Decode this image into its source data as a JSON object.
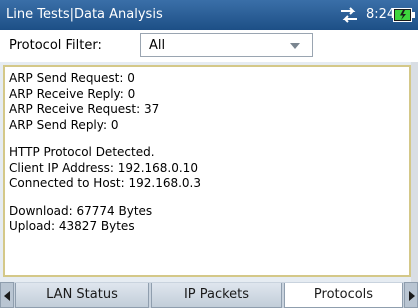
{
  "window": {
    "title": "Line Tests|Data Analysis",
    "time": "8:24",
    "network_icon": "network-activity-icon",
    "battery_icon": "battery-charging-icon"
  },
  "filter": {
    "label": "Protocol Filter:",
    "selected": "All"
  },
  "content": {
    "lines": [
      "ARP Send Request: 0",
      "ARP Receive Reply: 0",
      "ARP Receive Request: 37",
      "ARP Send Reply: 0",
      "",
      "HTTP Protocol Detected.",
      "Client IP Address: 192.168.0.10",
      "Connected to Host: 192.168.0.3",
      "",
      "Download: 67774 Bytes",
      "Upload: 43827 Bytes"
    ]
  },
  "tabs": [
    {
      "label": "LAN Status",
      "active": false
    },
    {
      "label": "IP Packets",
      "active": false
    },
    {
      "label": "Protocols",
      "active": true
    }
  ],
  "colors": {
    "titlebar": "#1d4f86",
    "panel_border": "#d4c888",
    "battery_fill": "#3dd43d"
  }
}
